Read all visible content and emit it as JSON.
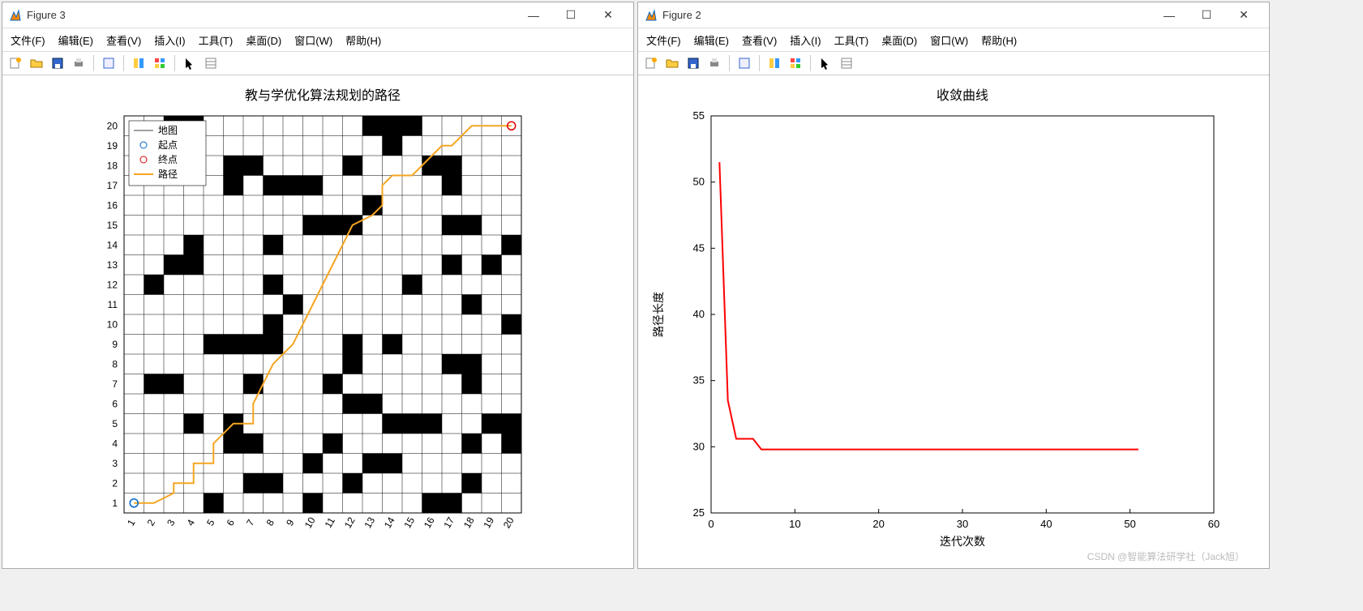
{
  "figure3": {
    "title": "Figure 3",
    "menus": [
      "文件(F)",
      "编辑(E)",
      "查看(V)",
      "插入(I)",
      "工具(T)",
      "桌面(D)",
      "窗口(W)",
      "帮助(H)"
    ],
    "plot_title": "教与学优化算法规划的路径",
    "legend": {
      "map": "地图",
      "start": "起点",
      "end": "终点",
      "path": "路径"
    },
    "xticks": [
      "1",
      "2",
      "3",
      "4",
      "5",
      "6",
      "7",
      "8",
      "9",
      "10",
      "11",
      "12",
      "13",
      "14",
      "15",
      "16",
      "17",
      "18",
      "19",
      "20"
    ],
    "yticks": [
      "1",
      "2",
      "3",
      "4",
      "5",
      "6",
      "7",
      "8",
      "9",
      "10",
      "11",
      "12",
      "13",
      "14",
      "15",
      "16",
      "17",
      "18",
      "19",
      "20"
    ]
  },
  "figure2": {
    "title": "Figure 2",
    "plot_title": "收敛曲线",
    "xlabel": "迭代次数",
    "ylabel": "路径长度",
    "xticks": [
      "0",
      "10",
      "20",
      "30",
      "40",
      "50",
      "60"
    ],
    "yticks": [
      "25",
      "30",
      "35",
      "40",
      "45",
      "50",
      "55"
    ]
  },
  "watermark": "CSDN @智能算法研学社（Jack旭）",
  "chart_data": [
    {
      "type": "heatmap",
      "title": "教与学优化算法规划的路径",
      "xlabel": "",
      "ylabel": "",
      "xlim": [
        0.5,
        20.5
      ],
      "ylim": [
        0.5,
        20.5
      ],
      "legend": [
        "地图",
        "起点",
        "终点",
        "路径"
      ],
      "grid_size": 20,
      "obstacles": [
        [
          3,
          20
        ],
        [
          4,
          20
        ],
        [
          13,
          20
        ],
        [
          14,
          20
        ],
        [
          15,
          20
        ],
        [
          14,
          19
        ],
        [
          6,
          18
        ],
        [
          7,
          18
        ],
        [
          12,
          18
        ],
        [
          16,
          18
        ],
        [
          17,
          18
        ],
        [
          6,
          17
        ],
        [
          8,
          17
        ],
        [
          9,
          17
        ],
        [
          10,
          17
        ],
        [
          17,
          17
        ],
        [
          13,
          16
        ],
        [
          10,
          15
        ],
        [
          11,
          15
        ],
        [
          12,
          15
        ],
        [
          17,
          15
        ],
        [
          18,
          15
        ],
        [
          4,
          14
        ],
        [
          8,
          14
        ],
        [
          20,
          14
        ],
        [
          3,
          13
        ],
        [
          4,
          13
        ],
        [
          17,
          13
        ],
        [
          19,
          13
        ],
        [
          2,
          12
        ],
        [
          8,
          12
        ],
        [
          15,
          12
        ],
        [
          9,
          11
        ],
        [
          18,
          11
        ],
        [
          8,
          10
        ],
        [
          20,
          10
        ],
        [
          5,
          9
        ],
        [
          6,
          9
        ],
        [
          7,
          9
        ],
        [
          8,
          9
        ],
        [
          12,
          9
        ],
        [
          14,
          9
        ],
        [
          12,
          8
        ],
        [
          17,
          8
        ],
        [
          18,
          8
        ],
        [
          2,
          7
        ],
        [
          3,
          7
        ],
        [
          7,
          7
        ],
        [
          11,
          7
        ],
        [
          18,
          7
        ],
        [
          12,
          6
        ],
        [
          13,
          6
        ],
        [
          4,
          5
        ],
        [
          6,
          5
        ],
        [
          14,
          5
        ],
        [
          15,
          5
        ],
        [
          16,
          5
        ],
        [
          19,
          5
        ],
        [
          20,
          5
        ],
        [
          6,
          4
        ],
        [
          7,
          4
        ],
        [
          11,
          4
        ],
        [
          18,
          4
        ],
        [
          20,
          4
        ],
        [
          10,
          3
        ],
        [
          13,
          3
        ],
        [
          14,
          3
        ],
        [
          7,
          2
        ],
        [
          8,
          2
        ],
        [
          12,
          2
        ],
        [
          18,
          2
        ],
        [
          5,
          1
        ],
        [
          10,
          1
        ],
        [
          16,
          1
        ],
        [
          17,
          1
        ]
      ],
      "start": [
        1,
        1
      ],
      "end": [
        20,
        20
      ],
      "path": [
        [
          1,
          1
        ],
        [
          2,
          1
        ],
        [
          3,
          1.5
        ],
        [
          3,
          2
        ],
        [
          4,
          2
        ],
        [
          4,
          3
        ],
        [
          5,
          3
        ],
        [
          5,
          4
        ],
        [
          6,
          5
        ],
        [
          7,
          5
        ],
        [
          7,
          6
        ],
        [
          7.5,
          7
        ],
        [
          8,
          8
        ],
        [
          9,
          9
        ],
        [
          9.5,
          10
        ],
        [
          10,
          11
        ],
        [
          10.5,
          12
        ],
        [
          11,
          13
        ],
        [
          11.5,
          14
        ],
        [
          12,
          15
        ],
        [
          13,
          15.5
        ],
        [
          13.5,
          16
        ],
        [
          13.5,
          17
        ],
        [
          14,
          17.5
        ],
        [
          15,
          17.5
        ],
        [
          15.5,
          18
        ],
        [
          16.5,
          19
        ],
        [
          17,
          19
        ],
        [
          18,
          20
        ],
        [
          19,
          20
        ],
        [
          20,
          20
        ]
      ]
    },
    {
      "type": "line",
      "title": "收敛曲线",
      "xlabel": "迭代次数",
      "ylabel": "路径长度",
      "xlim": [
        0,
        60
      ],
      "ylim": [
        25,
        55
      ],
      "series": [
        {
          "name": "路径长度",
          "color": "#ff0000",
          "x": [
            1,
            2,
            3,
            4,
            5,
            6,
            7,
            8,
            9,
            10,
            15,
            20,
            25,
            30,
            35,
            40,
            45,
            50,
            51
          ],
          "y": [
            51.5,
            33.5,
            30.6,
            30.6,
            30.6,
            29.8,
            29.8,
            29.8,
            29.8,
            29.8,
            29.8,
            29.8,
            29.8,
            29.8,
            29.8,
            29.8,
            29.8,
            29.8,
            29.8
          ]
        }
      ]
    }
  ]
}
